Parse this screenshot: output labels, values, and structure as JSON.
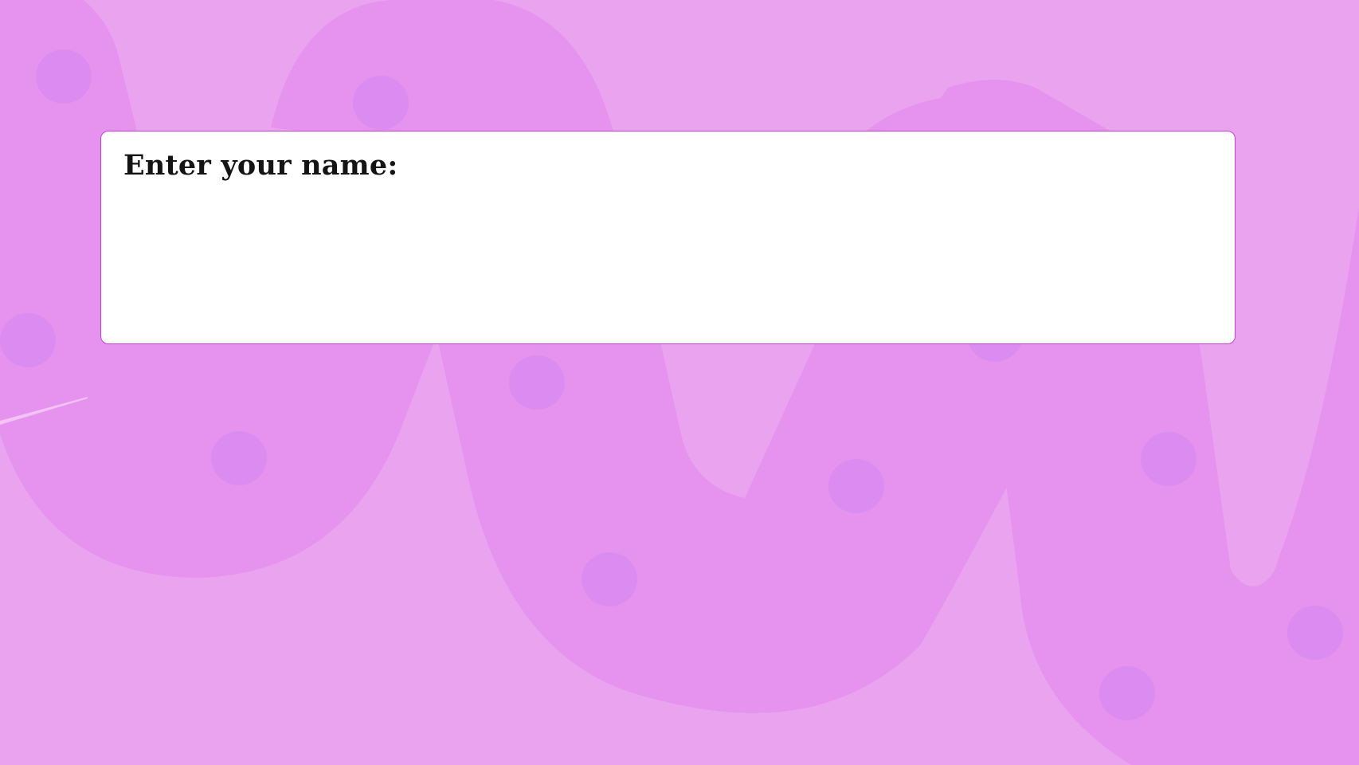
{
  "theme": {
    "background": "#eaa4ef",
    "blob": "#e693ef",
    "dot": "#dc8cf0",
    "panel_border": "#c640d6",
    "panel_background": "#ffffff",
    "text": "#141414"
  },
  "dialog": {
    "prompt": "Enter your name:",
    "name_value": "",
    "name_placeholder": ""
  },
  "decorations": {
    "background_icon": "abstract-blob-pattern"
  }
}
